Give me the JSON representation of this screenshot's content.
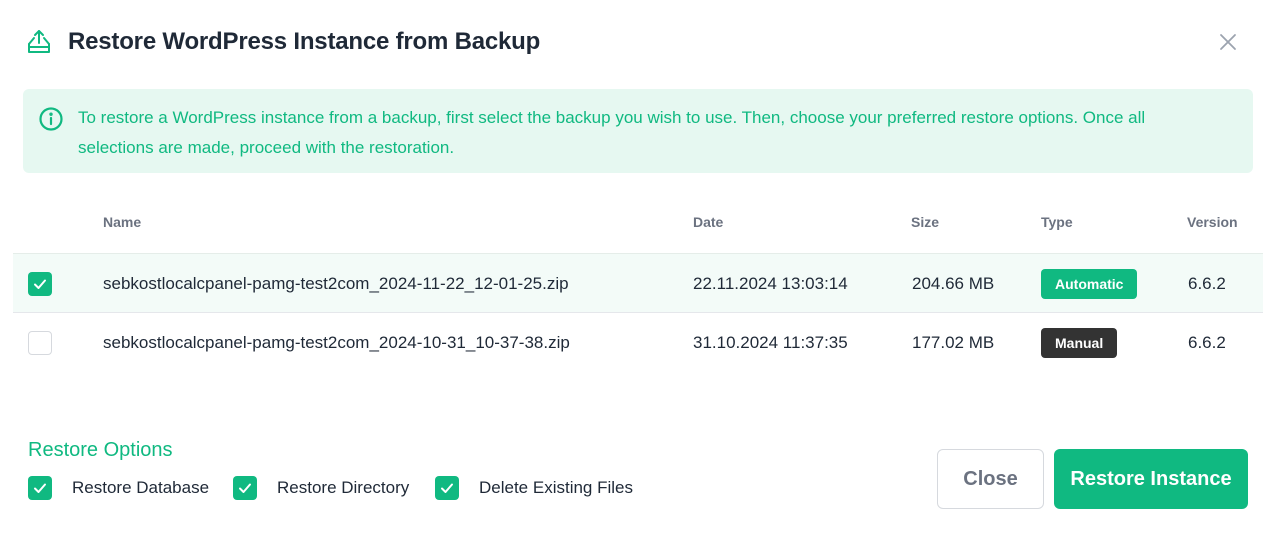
{
  "header": {
    "title": "Restore WordPress Instance from Backup",
    "icon": "upload-tray-icon",
    "close_icon": "close-x-icon"
  },
  "info": {
    "icon": "info-circle-icon",
    "text": "To restore a WordPress instance from a backup, first select the backup you wish to use. Then, choose your preferred restore options. Once all selections are made, proceed with the restoration."
  },
  "table": {
    "columns": [
      "Name",
      "Date",
      "Size",
      "Type",
      "Version"
    ],
    "rows": [
      {
        "selected": true,
        "name": "sebkostlocalcpanel-pamg-test2com_2024-11-22_12-01-25.zip",
        "date": "22.11.2024 13:03:14",
        "size": "204.66 MB",
        "type": "Automatic",
        "version": "6.6.2"
      },
      {
        "selected": false,
        "name": "sebkostlocalcpanel-pamg-test2com_2024-10-31_10-37-38.zip",
        "date": "31.10.2024 11:37:35",
        "size": "177.02 MB",
        "type": "Manual",
        "version": "6.6.2"
      }
    ]
  },
  "options": {
    "title": "Restore Options",
    "items": [
      {
        "label": "Restore Database",
        "checked": true
      },
      {
        "label": "Restore Directory",
        "checked": true
      },
      {
        "label": "Delete Existing Files",
        "checked": true
      }
    ]
  },
  "buttons": {
    "close_label": "Close",
    "restore_label": "Restore Instance"
  },
  "colors": {
    "accent": "#10b981",
    "info_bg": "#e6f8f1",
    "manual_badge": "#333333",
    "text": "#1f2937",
    "muted": "#6b7280"
  }
}
